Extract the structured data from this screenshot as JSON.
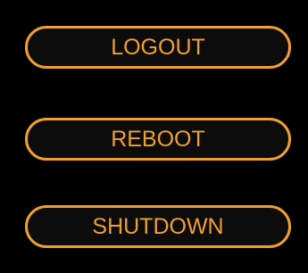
{
  "colors": {
    "background": "#000000",
    "accent": "#f0a030",
    "button_fill": "#0c0c0c"
  },
  "buttons": {
    "logout": "LOGOUT",
    "reboot": "REBOOT",
    "shutdown": "SHUTDOWN"
  }
}
